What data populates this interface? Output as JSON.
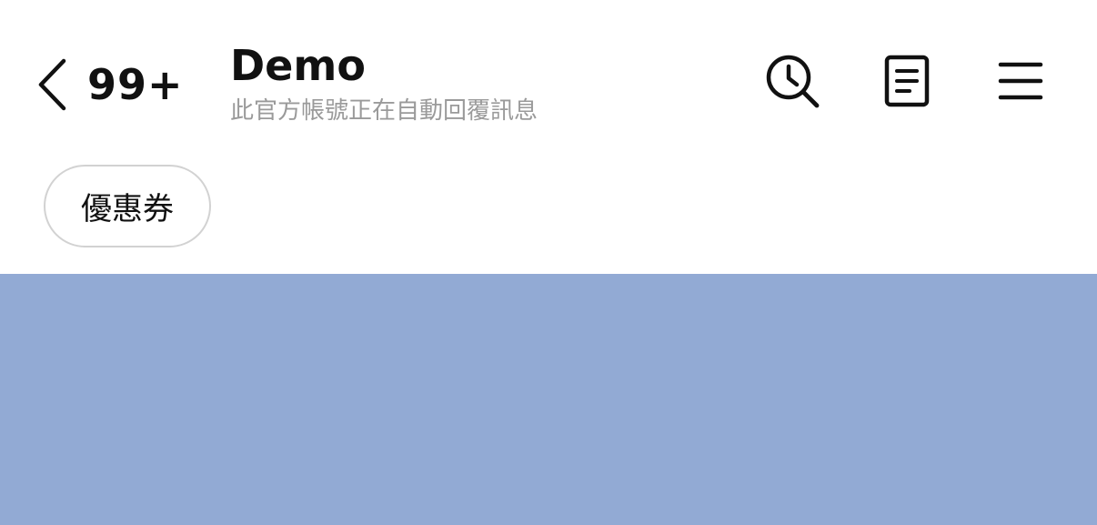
{
  "header": {
    "unread_count": "99+",
    "account_name": "Demo",
    "account_status": "此官方帳號正在自動回覆訊息",
    "icons": {
      "back": "chevron-left-icon",
      "search": "search-history-icon",
      "notes": "notes-icon",
      "menu": "hamburger-menu-icon"
    }
  },
  "quick_replies": [
    {
      "label": "優惠券"
    }
  ],
  "chat": {
    "background_color": "#92AAD4"
  },
  "colors": {
    "text_primary": "#111111",
    "text_secondary": "#9A9A9A",
    "chip_border": "#D2D2D2",
    "chat_background": "#92AAD4"
  }
}
